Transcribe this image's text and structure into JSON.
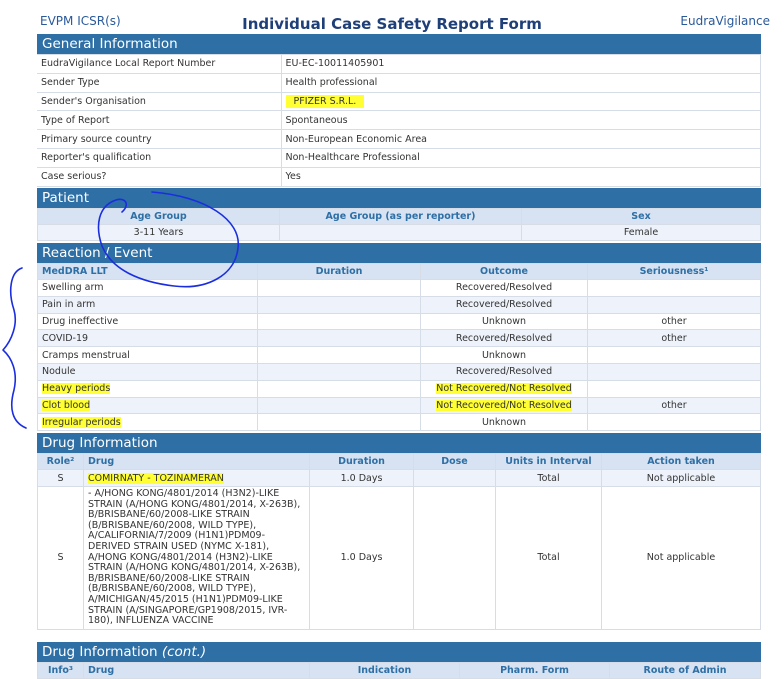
{
  "header": {
    "left": "EVPM ICSR(s)",
    "title": "Individual Case Safety Report Form",
    "right": "EudraVigilance"
  },
  "general": {
    "title": "General Information",
    "rows": [
      {
        "label": "EudraVigilance Local Report Number",
        "value": "EU-EC-10011405901"
      },
      {
        "label": "Sender Type",
        "value": "Health professional"
      },
      {
        "label": "Sender's Organisation",
        "value": "PFIZER S.R.L."
      },
      {
        "label": "Type of Report",
        "value": "Spontaneous"
      },
      {
        "label": "Primary source country",
        "value": "Non-European Economic Area"
      },
      {
        "label": "Reporter's qualification",
        "value": "Non-Healthcare Professional"
      },
      {
        "label": "Case serious?",
        "value": "Yes"
      }
    ]
  },
  "patient": {
    "title": "Patient",
    "headers": [
      "Age Group",
      "Age Group (as per reporter)",
      "Sex"
    ],
    "values": [
      "3-11 Years",
      "",
      "Female"
    ]
  },
  "reaction": {
    "title": "Reaction / Event",
    "headers": [
      "MedDRA LLT",
      "Duration",
      "Outcome",
      "Seriousness¹"
    ],
    "rows": [
      [
        "Swelling arm",
        "",
        "Recovered/Resolved",
        ""
      ],
      [
        "Pain in arm",
        "",
        "Recovered/Resolved",
        ""
      ],
      [
        "Drug ineffective",
        "",
        "Unknown",
        "other"
      ],
      [
        "COVID-19",
        "",
        "Recovered/Resolved",
        "other"
      ],
      [
        "Cramps menstrual",
        "",
        "Unknown",
        ""
      ],
      [
        "Nodule",
        "",
        "Recovered/Resolved",
        ""
      ],
      [
        "Heavy periods",
        "",
        "Not Recovered/Not Resolved",
        ""
      ],
      [
        "Clot blood",
        "",
        "Not Recovered/Not Resolved",
        "other"
      ],
      [
        "Irregular periods",
        "",
        "Unknown",
        ""
      ]
    ]
  },
  "drug": {
    "title": "Drug Information",
    "headers": [
      "Role²",
      "Drug",
      "Duration",
      "Dose",
      "Units in Interval",
      "Action taken"
    ],
    "rows": [
      [
        "S",
        "COMIRNATY - TOZINAMERAN",
        "1.0 Days",
        "",
        "Total",
        "Not applicable"
      ],
      [
        "S",
        "- A/HONG KONG/4801/2014 (H3N2)-LIKE STRAIN (A/HONG KONG/4801/2014, X-263B), B/BRISBANE/60/2008-LIKE STRAIN (B/BRISBANE/60/2008, WILD TYPE), A/CALIFORNIA/7/2009 (H1N1)PDM09-DERIVED STRAIN USED (NYMC X-181), A/HONG KONG/4801/2014 (H3N2)-LIKE STRAIN (A/HONG KONG/4801/2014, X-263B), B/BRISBANE/60/2008-LIKE STRAIN (B/BRISBANE/60/2008, WILD TYPE), A/MICHIGAN/45/2015 (H1N1)PDM09-LIKE STRAIN (A/SINGAPORE/GP1908/2015, IVR-180), INFLUENZA VACCINE",
        "1.0 Days",
        "",
        "Total",
        "Not applicable"
      ]
    ]
  },
  "drug_cont": {
    "title": "Drug Information",
    "title_suffix": "(cont.)",
    "headers": [
      "Info³",
      "Drug",
      "Indication",
      "Pharm. Form",
      "Route of Admin"
    ]
  },
  "colors": {
    "section": "#2e6fa5",
    "header_bg": "#d7e3f2",
    "alt_row": "#eef3fb",
    "highlight": "#ffff33",
    "ink": "#1a2ee0"
  }
}
